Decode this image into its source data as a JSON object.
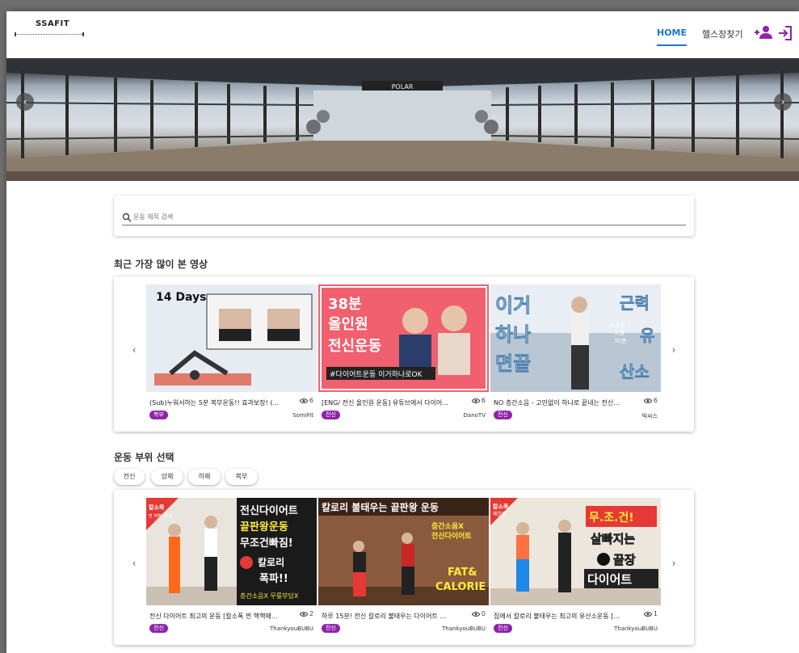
{
  "header": {
    "logo": "SSAFIT",
    "nav": {
      "home": "HOME",
      "gym_finder": "헬스장찾기"
    },
    "accent_color": "#1976d2"
  },
  "banner": {
    "sign": "POLAR",
    "prev_icon": "chevron-left-icon",
    "next_icon": "chevron-right-icon"
  },
  "search": {
    "placeholder": "운동 제목 검색",
    "value": ""
  },
  "popular": {
    "title": "최근 가장 많이 본 영상",
    "videos": [
      {
        "title": "(Sub)누워서하는 5분 복부운동!! 효과보장! (...",
        "views": "6",
        "tag": "복부",
        "channel": "SomiFit",
        "overlay": [
          "14 Days"
        ]
      },
      {
        "title": "[ENG/ 전신 올인원 운동] 유튜브에서 다이어...",
        "views": "6",
        "tag": "전신",
        "channel": "DanoTV",
        "overlay": [
          "38분",
          "올인원",
          "전신운동",
          "#다이어트운동 이거하나로OK"
        ]
      },
      {
        "title": "NO 층간소음 - 고민없이 하나로 끝내는 전신...",
        "views": "6",
        "tag": "전신",
        "channel": "빅씨스",
        "overlay": [
          "이거",
          "하나",
          "면끝",
          "근력",
          "유",
          "산소",
          "노층간",
          "소음",
          "30분"
        ]
      }
    ]
  },
  "parts": {
    "title": "운동 부위 선택",
    "chips": [
      "전신",
      "상체",
      "하체",
      "복부"
    ],
    "videos": [
      {
        "title": "전신 다이어트 최고의 운동 [칼소폭 찐 핵핵매...",
        "views": "2",
        "tag": "전신",
        "channel": "ThankyouBUBU",
        "overlay": [
          "전신다이어트",
          "끝판왕운동",
          "무조건빠짐!",
          "칼로리",
          "폭파!!",
          "층간소음X 무릎부담X",
          "칼소폭",
          "찐 핵핵매운맛"
        ]
      },
      {
        "title": "하루 15분! 전신 칼로리 불태우는 다이어트 ...",
        "views": "0",
        "tag": "전신",
        "channel": "ThankyouBUBU",
        "overlay": [
          "칼로리 불태우는 끝판왕 운동",
          "층간소음X",
          "전신다이어트",
          "FAT&",
          "CALORIE"
        ]
      },
      {
        "title": "집에서 칼로리 불태우는 최고의 유산소운동 [...",
        "views": "1",
        "tag": "전신",
        "channel": "ThankyouBUBU",
        "overlay": [
          "무.조.건!",
          "살빠지는",
          "끝장",
          "다이어트",
          "칼소폭",
          "매운맛"
        ]
      }
    ]
  },
  "colors": {
    "badge": "#8e24aa"
  }
}
